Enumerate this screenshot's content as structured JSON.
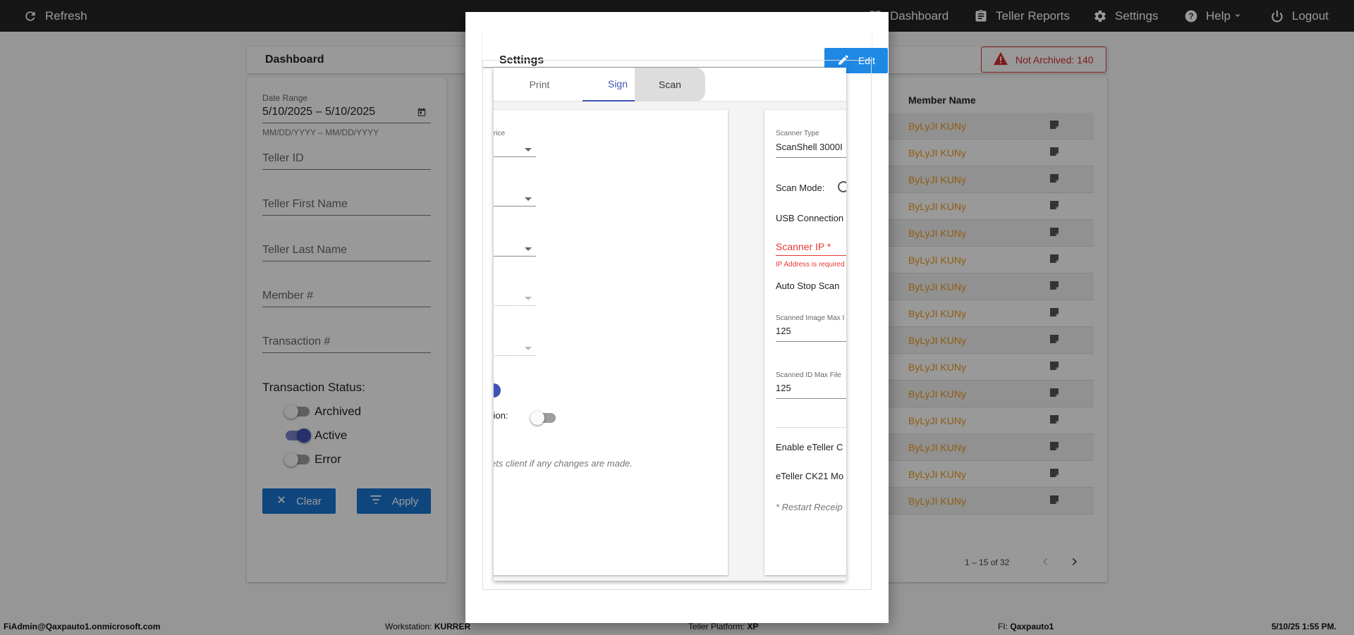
{
  "topbar": {
    "refresh": "Refresh",
    "dashboard": "Dashboard",
    "teller_reports": "Teller Reports",
    "settings": "Settings",
    "help": "Help",
    "logout": "Logout"
  },
  "dashboard": {
    "title": "Dashboard",
    "not_archived": "Not Archived: 140"
  },
  "filters": {
    "date_range_label": "Date Range",
    "date_range_value": "5/10/2025 – 5/10/2025",
    "date_hint": "MM/DD/YYYY – MM/DD/YYYY",
    "teller_id": "Teller ID",
    "teller_first_name": "Teller First Name",
    "teller_last_name": "Teller Last Name",
    "member_number": "Member #",
    "transaction_number": "Transaction #",
    "status_label": "Transaction Status:",
    "statuses": [
      {
        "label": "Archived",
        "on": false
      },
      {
        "label": "Active",
        "on": true
      },
      {
        "label": "Error",
        "on": false
      }
    ],
    "clear": "Clear",
    "apply": "Apply"
  },
  "table": {
    "column_member_name": "Member Name",
    "rows": [
      "ByLyJI KUNy",
      "ByLyJI KUNy",
      "ByLyJI KUNy",
      "ByLyJI KUNy",
      "ByLyJI KUNy",
      "ByLyJI KUNy",
      "ByLyJI KUNy",
      "ByLyJI KUNy",
      "ByLyJI KUNy",
      "ByLyJI KUNy",
      "ByLyJI KUNy",
      "ByLyJI KUNy",
      "ByLyJI KUNy",
      "ByLyJI KUNy",
      "ByLyJI KUNy"
    ],
    "pager": "1 – 15 of 32"
  },
  "modal": {
    "title": "Settings",
    "edit": "Edit",
    "tabs": [
      "Print",
      "Sign",
      "Scan"
    ],
    "left_panel": {
      "device_label_fragment": "rice",
      "location_fragment": "tion:",
      "restart_note_fragment": "ets client if any changes are made."
    },
    "right_panel": {
      "scanner_type_label": "Scanner Type",
      "scanner_type_value": "ScanShell 3000I",
      "scan_mode_label": "Scan Mode:",
      "usb_connection": "USB Connection",
      "scanner_ip_label": "Scanner IP *",
      "scanner_ip_error": "IP Address is required",
      "auto_stop_scan": "Auto Stop Scan",
      "image_max_label": "Scanned Image Max I",
      "image_max_value": "125",
      "id_max_label": "Scanned ID Max File",
      "id_max_value": "125",
      "enable_eteller": "Enable eTeller C",
      "eteller_ck21": "eTeller CK21 Mo",
      "restart_note": "* Restart Receip"
    }
  },
  "footer": {
    "user": "FiAdmin@Qaxpauto1.onmicrosoft.com",
    "workstation_label": "Workstation:",
    "workstation_value": "KURRER",
    "platform_label": "Teller Platform:",
    "platform_value": "XP",
    "fi_label": "FI:",
    "fi_value": "Qaxpauto1",
    "datetime": "5/10/25 1:55 PM."
  },
  "colors": {
    "accent": "#3f51b5",
    "button_blue": "#1976d2",
    "error": "#e53935",
    "member_name": "#ef9a1a"
  }
}
